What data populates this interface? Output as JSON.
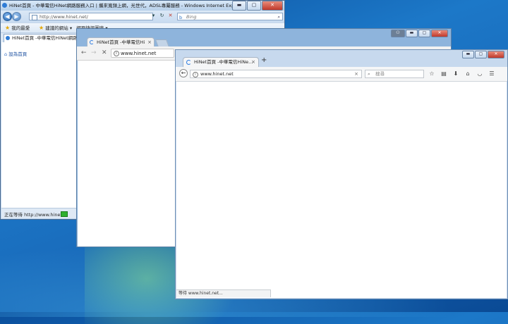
{
  "ie": {
    "title": "HiNet首頁 - 中華電信HiNet網路服務入口 | 攜來寬頻上網，光世代，ADSL專屬服務 - Windows Internet Explorer",
    "address": "http://www.hinet.net/",
    "search_engine": "Bing",
    "favorites_label": "我的最愛",
    "suggested_sites": "建議的網站 ▾",
    "web_slice": "網頁快訊圖庫 ▾",
    "tab_title": "HiNet首頁 -中華電信HiNet網路服務...",
    "home_link": "設為首頁",
    "status_text": "正在等待 http://www.hinet."
  },
  "chrome": {
    "tab_title": "HiNet首頁 -中華電信Hi",
    "tab_close": "×",
    "omnibox": "www.hinet.net",
    "nav": {
      "back": "←",
      "forward": "→",
      "stop": "✕"
    },
    "info": "i"
  },
  "firefox": {
    "tab_title": "HiNet首頁 -中華電信HiNe...",
    "tab_close": "×",
    "new_tab": "+",
    "url": "www.hinet.net",
    "url_clear": "×",
    "search_placeholder": "搜尋",
    "status_text": "等待 www.hinet.net...",
    "toolbar_icons": [
      "bookmark-star-icon",
      "clipboard-icon",
      "download-icon",
      "home-icon",
      "pocket-icon",
      "menu-icon"
    ]
  },
  "window_controls": {
    "minimize": "▬",
    "maximize": "▢",
    "close": "✕"
  },
  "colors": {
    "desktop": "#1a6dbd",
    "accent": "#2f7de1",
    "progress": "#2fb02f"
  }
}
